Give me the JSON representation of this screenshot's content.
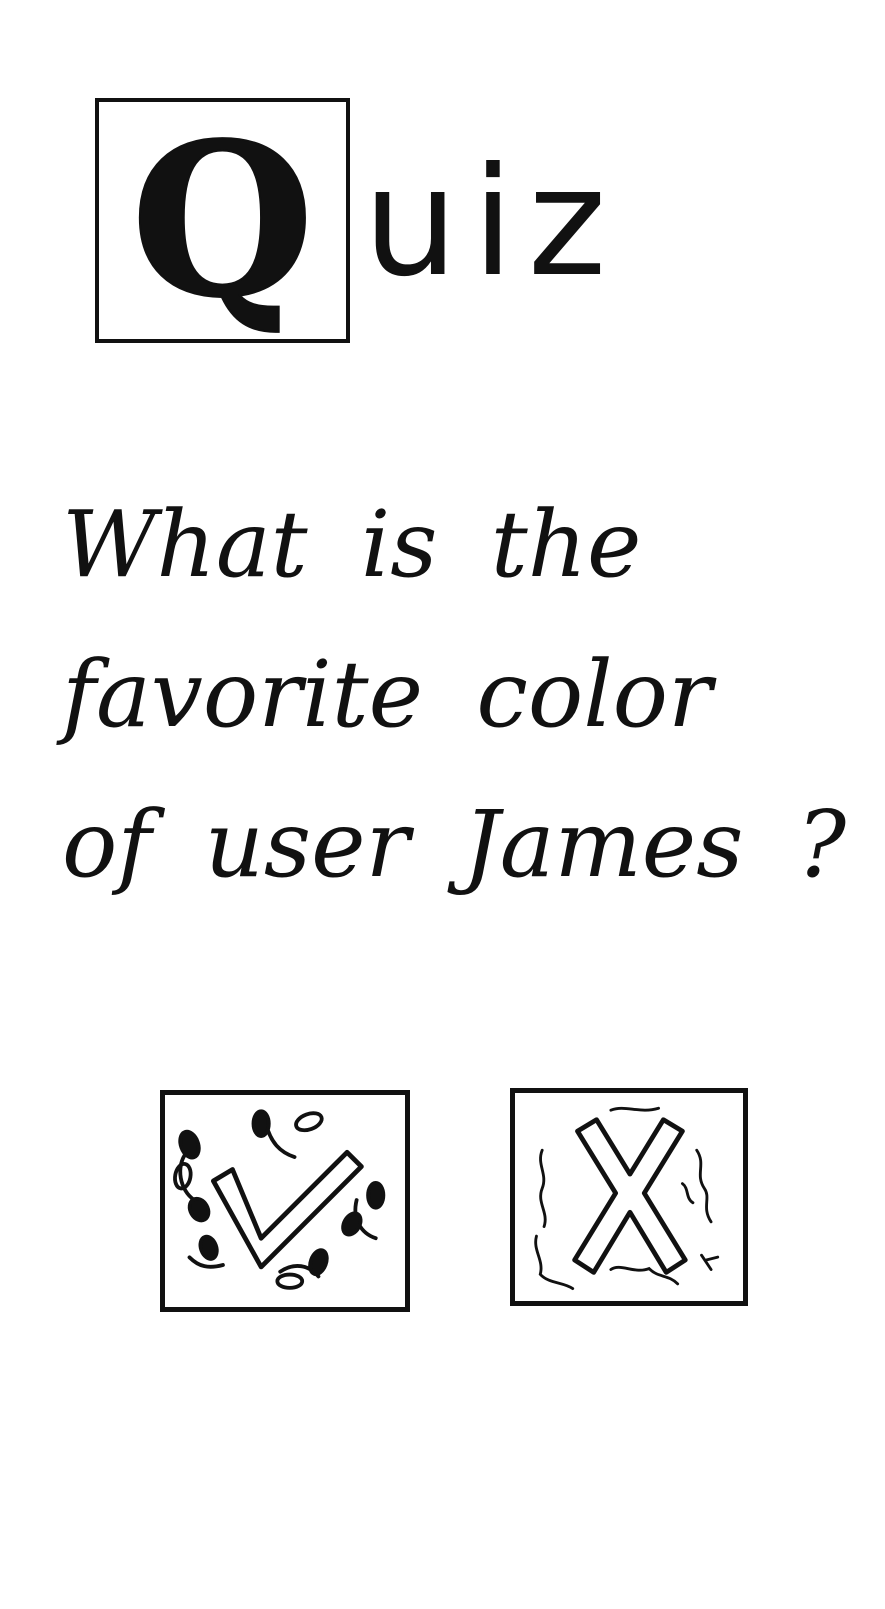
{
  "header": {
    "title_initial": "Q",
    "title_rest": "uiz",
    "title_icon": "ornamental-drop-cap"
  },
  "question": {
    "lines": [
      "What is the",
      "favorite color",
      "of user James ?"
    ]
  },
  "answers": [
    {
      "icon": "check-icon",
      "decoration": "leaves"
    },
    {
      "icon": "cross-icon",
      "decoration": "vines"
    }
  ],
  "colors": {
    "ink": "#111111",
    "paper": "#ffffff"
  }
}
